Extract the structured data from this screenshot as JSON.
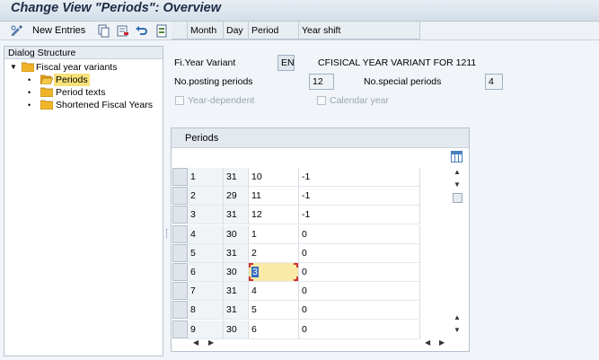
{
  "window": {
    "title": "Change View \"Periods\": Overview"
  },
  "toolbar": {
    "new_entries_label": "New Entries",
    "icons": [
      "toggle-edit-icon",
      "new-entries-icon",
      "copy-icon",
      "delete-icon",
      "undo-icon",
      "select-all-icon",
      "select-block-icon",
      "deselect-all-icon"
    ]
  },
  "dialog_structure": {
    "header": "Dialog Structure",
    "root": "Fiscal year variants",
    "items": [
      {
        "label": "Periods",
        "selected": true
      },
      {
        "label": "Period texts",
        "selected": false
      },
      {
        "label": "Shortened Fiscal Years",
        "selected": false
      }
    ]
  },
  "header_fields": {
    "fy_variant_label": "Fi.Year Variant",
    "fy_variant_value": "EN",
    "fy_variant_desc": "CFISICAL YEAR VARIANT FOR 1211",
    "posting_periods_label": "No.posting periods",
    "posting_periods_value": "12",
    "special_periods_label": "No.special periods",
    "special_periods_value": "4",
    "year_dependent_label": "Year-dependent",
    "calendar_year_label": "Calendar year"
  },
  "periods_table": {
    "title": "Periods",
    "columns": [
      "Month",
      "Day",
      "Period",
      "Year shift"
    ],
    "rows": [
      [
        "1",
        "31",
        "10",
        "-1"
      ],
      [
        "2",
        "29",
        "11",
        "-1"
      ],
      [
        "3",
        "31",
        "12",
        "-1"
      ],
      [
        "4",
        "30",
        "1",
        "0"
      ],
      [
        "5",
        "31",
        "2",
        "0"
      ],
      [
        "6",
        "30",
        "3",
        "0"
      ],
      [
        "7",
        "31",
        "4",
        "0"
      ],
      [
        "8",
        "31",
        "5",
        "0"
      ],
      [
        "9",
        "30",
        "6",
        "0"
      ]
    ],
    "active_cell": {
      "row": 5,
      "col": 2
    }
  },
  "colors": {
    "selection_yellow": "#f9e27b",
    "active_cell": "#fbe9a8",
    "text_highlight": "#3a6dc0",
    "folder": "#f0b429"
  }
}
